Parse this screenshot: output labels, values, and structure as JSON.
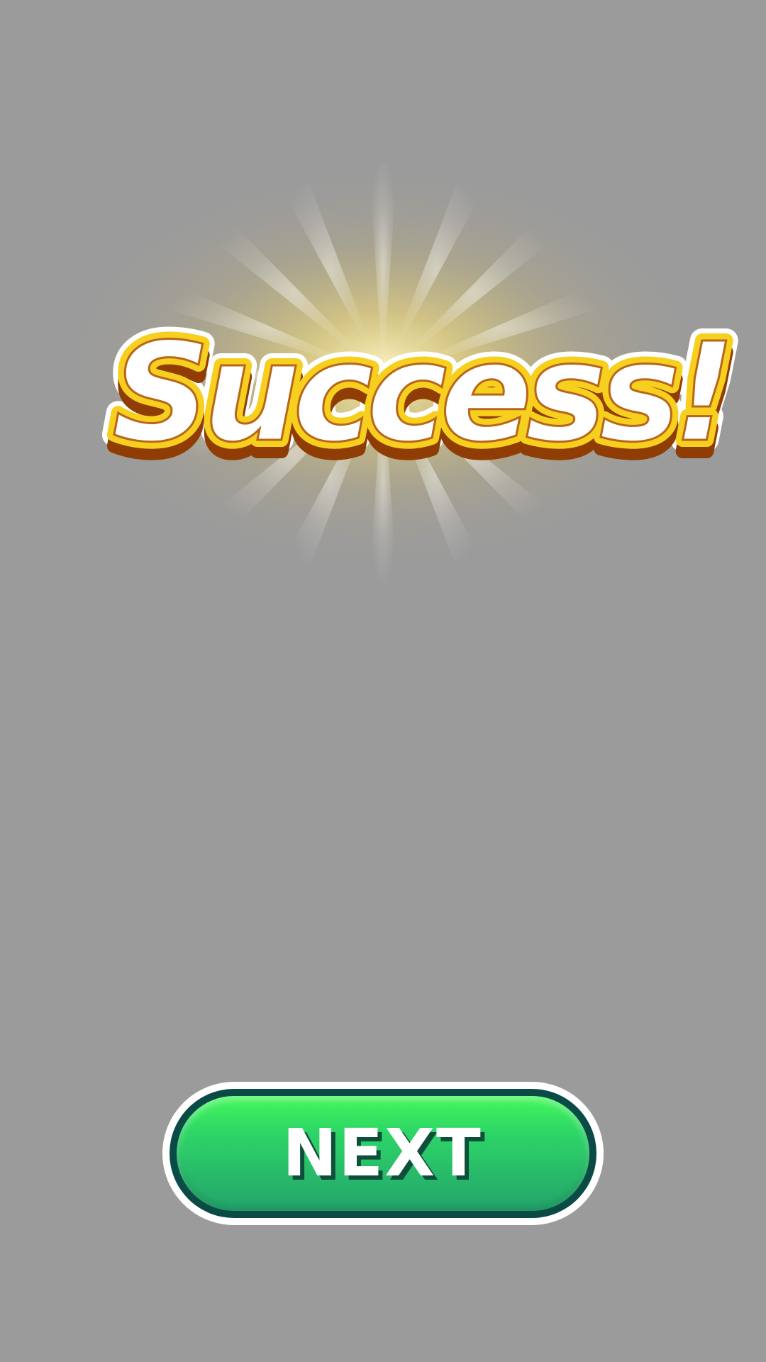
{
  "screen": {
    "background_color": "#9b9b9b"
  },
  "result": {
    "title": "Success!",
    "colors": {
      "fill": "#ffffff",
      "outline": "#f7cf1f",
      "outer_outline": "#ffffff",
      "shadow": "#8f3d05",
      "glow": "#f5e38a"
    }
  },
  "next_button": {
    "label": "NEXT",
    "colors": {
      "face_top": "#44f859",
      "face_bottom": "#23a56c",
      "rim": "#0a4b45",
      "border": "#ffffff",
      "text_shadow": "#0e4f3b"
    }
  }
}
